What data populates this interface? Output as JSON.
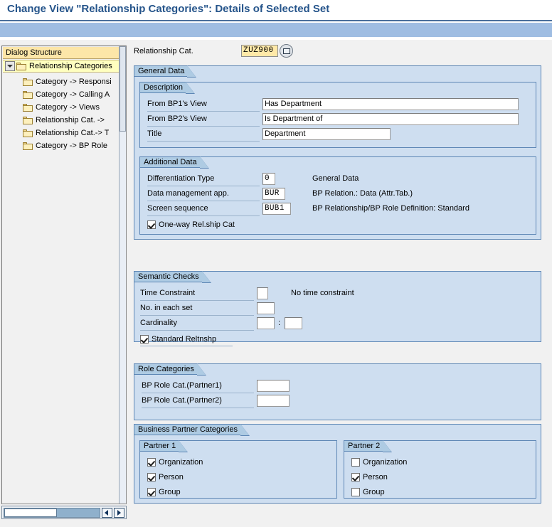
{
  "window": {
    "title": "Change View \"Relationship Categories\": Details of Selected Set"
  },
  "tree": {
    "header": "Dialog Structure",
    "root": {
      "label": "Relationship Categories",
      "icon": "open-folder-icon",
      "expander": "expanded-triangle-icon"
    },
    "children": [
      {
        "label": "Category -> Responsi",
        "icon": "folder-icon"
      },
      {
        "label": "Category -> Calling A",
        "icon": "folder-icon"
      },
      {
        "label": "Category -> Views",
        "icon": "folder-icon"
      },
      {
        "label": "Relationship Cat. ->",
        "icon": "folder-icon"
      },
      {
        "label": "Relationship Cat.-> T",
        "icon": "folder-icon"
      },
      {
        "label": "Category -> BP Role",
        "icon": "folder-icon"
      }
    ]
  },
  "key_field": {
    "label": "Relationship Cat.",
    "value": "ZUZ900",
    "help_icon": "value-help-icon"
  },
  "general_data": {
    "title": "General Data",
    "description": {
      "title": "Description",
      "fields": [
        {
          "label": "From BP1's View",
          "value": "Has Department"
        },
        {
          "label": "From BP2's View",
          "value": "Is Department of"
        },
        {
          "label": "Title",
          "value": "Department"
        }
      ]
    },
    "additional_data": {
      "title": "Additional Data",
      "fields": [
        {
          "label": "Differentiation Type",
          "value": "0",
          "text": "General Data"
        },
        {
          "label": "Data management app.",
          "value": "BUR",
          "text": "BP Relation.: Data (Attr.Tab.)"
        },
        {
          "label": "Screen sequence",
          "value": "BUB1",
          "text": "BP Relationship/BP Role Definition: Standard"
        }
      ],
      "checkbox": {
        "label": "One-way Rel.ship Cat",
        "checked": true
      }
    }
  },
  "semantic_checks": {
    "title": "Semantic Checks",
    "fields": [
      {
        "label": "Time Constraint",
        "value": "",
        "text": "No time constraint"
      },
      {
        "label": "No. in each set",
        "value": "",
        "text": ""
      }
    ],
    "cardinality": {
      "label": "Cardinality",
      "value1": "",
      "separator": ":",
      "value2": ""
    },
    "checkbox": {
      "label": "Standard Reltnshp",
      "checked": true
    }
  },
  "role_categories": {
    "title": "Role Categories",
    "fields": [
      {
        "label": "BP Role Cat.(Partner1)",
        "value": ""
      },
      {
        "label": "BP Role Cat.(Partner2)",
        "value": ""
      }
    ]
  },
  "business_partner_categories": {
    "title": "Business Partner Categories",
    "partner1": {
      "title": "Partner 1",
      "options": [
        {
          "label": "Organization",
          "checked": true
        },
        {
          "label": "Person",
          "checked": true
        },
        {
          "label": "Group",
          "checked": true
        }
      ]
    },
    "partner2": {
      "title": "Partner 2",
      "options": [
        {
          "label": "Organization",
          "checked": false
        },
        {
          "label": "Person",
          "checked": true
        },
        {
          "label": "Group",
          "checked": false
        }
      ]
    }
  },
  "scrollbars": {
    "horizontal_left_icon": "arrow-left-icon",
    "horizontal_right_icon": "arrow-right-icon"
  },
  "colors": {
    "title_blue": "#26558b",
    "toolbar_blue": "#9fbde2",
    "group_bg": "#cedef0",
    "group_title_bg": "#aecbe3",
    "group_border": "#5e87b5",
    "tree_header_bg": "#fce6a8",
    "tree_selected_bg": "#ffffbf",
    "key_field_bg": "#ffe9a8"
  }
}
